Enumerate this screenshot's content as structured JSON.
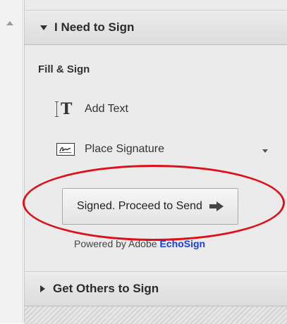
{
  "sections": {
    "top": {
      "title": "I Need to Sign",
      "expanded": true
    },
    "bottom": {
      "title": "Get Others to Sign",
      "expanded": false
    }
  },
  "fill_sign": {
    "label": "Fill & Sign",
    "tools": [
      {
        "label": "Add Text",
        "icon": "text-tool-icon"
      },
      {
        "label": "Place Signature",
        "icon": "signature-icon"
      }
    ]
  },
  "proceed_button": {
    "label": "Signed. Proceed to Send",
    "icon": "arrow-right-icon"
  },
  "powered_by": {
    "prefix": "Powered by Adobe",
    "brand": "EchoSign"
  },
  "colors": {
    "highlight": "#e0101a",
    "brand_link": "#1a3de0"
  }
}
